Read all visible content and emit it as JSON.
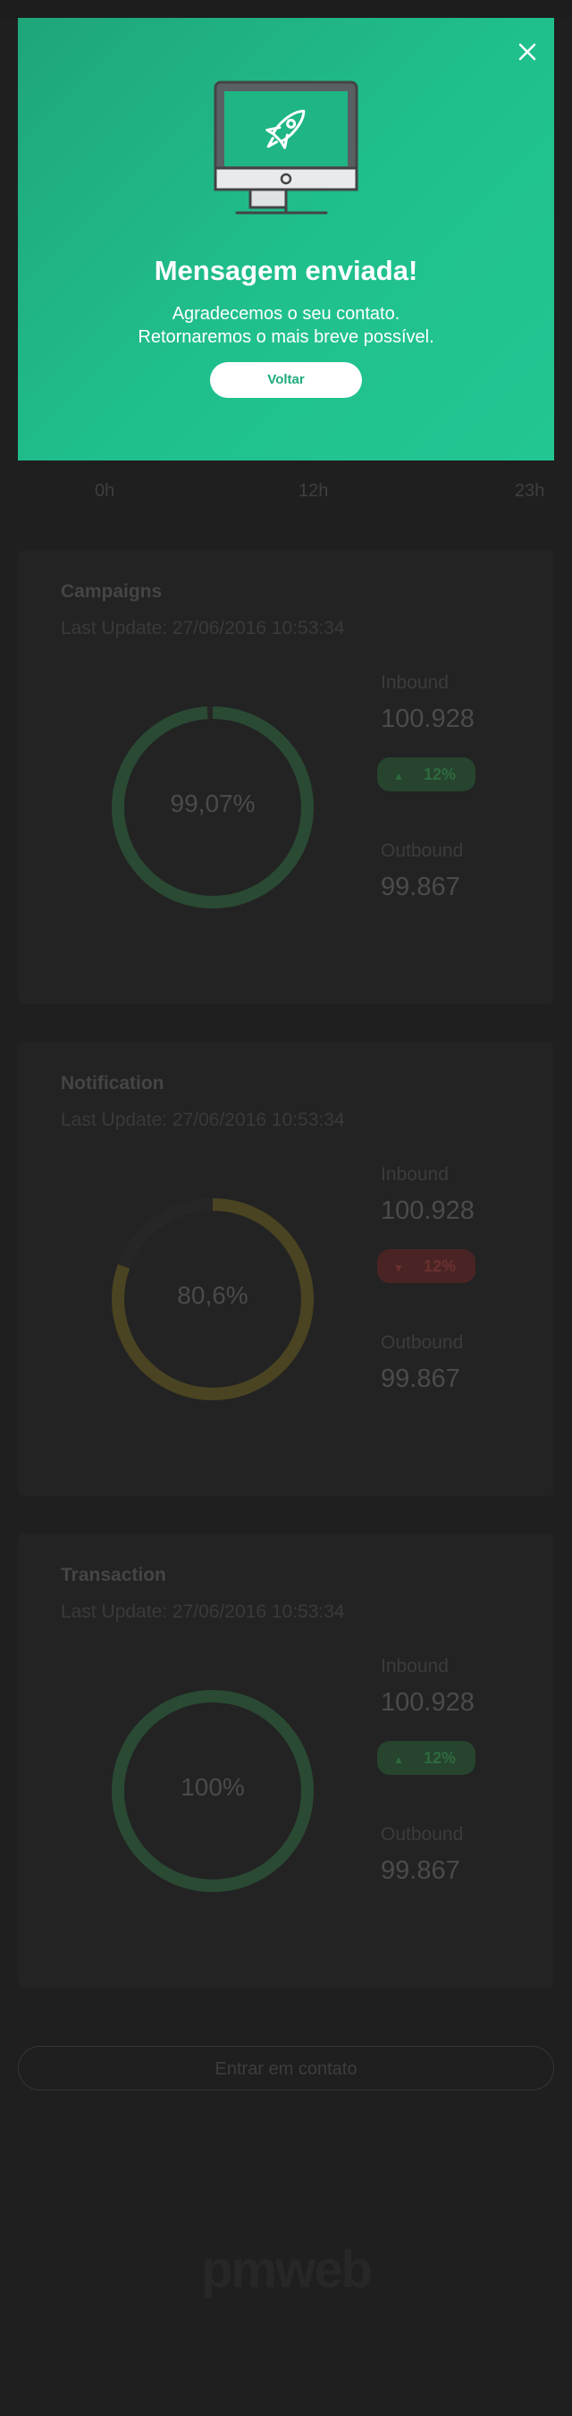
{
  "modal": {
    "title": "Mensagem enviada!",
    "line1": "Agradecemos o seu contato.",
    "line2": "Retornaremos o mais breve possível.",
    "button_label": "Voltar",
    "close_icon": "close-icon",
    "illustration_icon": "monitor-rocket-icon",
    "color": "#20b888"
  },
  "timeline": {
    "hours": [
      "0h",
      "12h",
      "23h"
    ]
  },
  "cards": [
    {
      "title": "Campaigns",
      "last_update": "Last Update:  27/06/2016  10:53:34",
      "percent_label": "99,07%",
      "percent": 99.07,
      "ring_color": "#2a4a34",
      "inbound_label": "Inbound",
      "inbound_value": "100.928",
      "badge": "12%",
      "badge_direction": "up",
      "outbound_label": "Outbound",
      "outbound_value": "99.867"
    },
    {
      "title": "Notification",
      "last_update": "Last Update:  27/06/2016  10:53:34",
      "percent_label": "80,6%",
      "percent": 80.6,
      "ring_color": "#4a4422",
      "inbound_label": "Inbound",
      "inbound_value": "100.928",
      "badge": "12%",
      "badge_direction": "down",
      "outbound_label": "Outbound",
      "outbound_value": "99.867"
    },
    {
      "title": "Transaction",
      "last_update": "Last Update:  27/06/2016  10:53:34",
      "percent_label": "100%",
      "percent": 100,
      "ring_color": "#2a4a34",
      "inbound_label": "Inbound",
      "inbound_value": "100.928",
      "badge": "12%",
      "badge_direction": "up",
      "outbound_label": "Outbound",
      "outbound_value": "99.867"
    }
  ],
  "contact_button": "Entrar em contato",
  "logo": "pmweb"
}
